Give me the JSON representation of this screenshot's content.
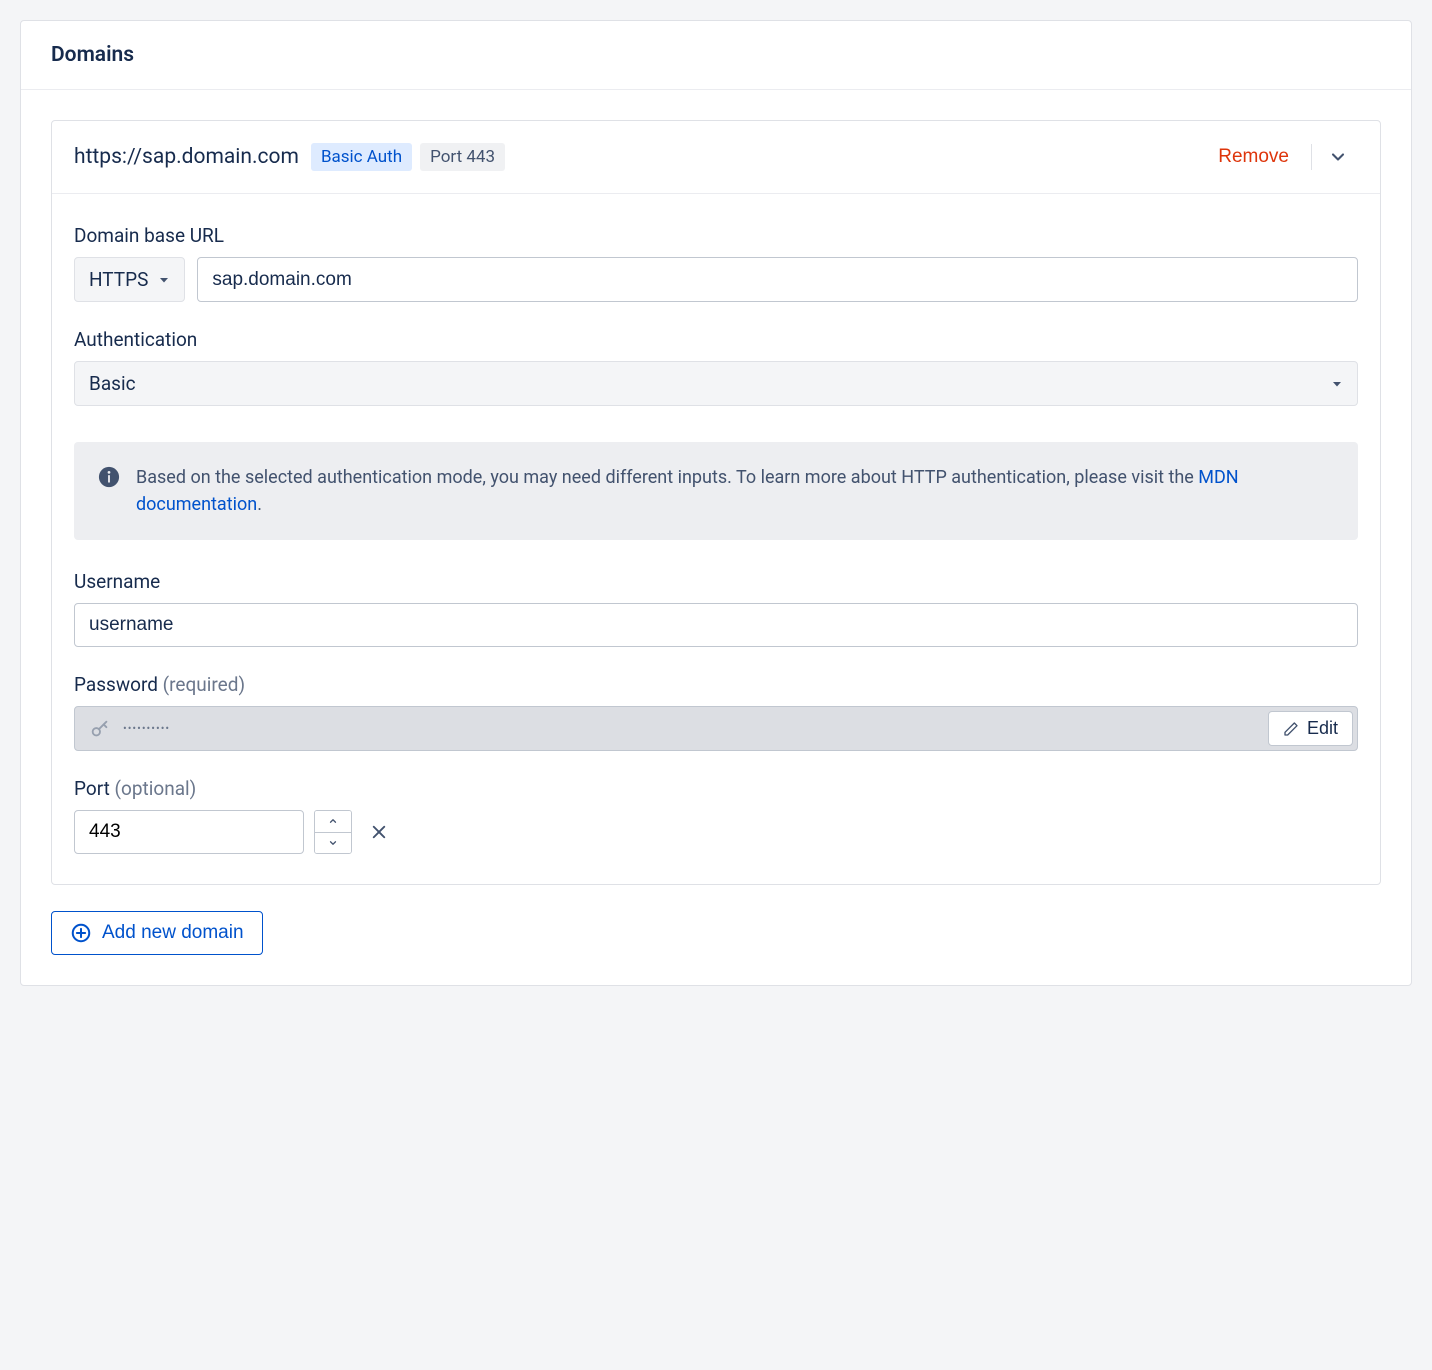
{
  "panel": {
    "title": "Domains"
  },
  "domain": {
    "url_display": "https://sap.domain.com",
    "auth_badge": "Basic Auth",
    "port_badge": "Port 443",
    "remove_label": "Remove"
  },
  "form": {
    "base_url_label": "Domain base URL",
    "protocol_value": "HTTPS",
    "domain_value": "sap.domain.com",
    "auth_label": "Authentication",
    "auth_value": "Basic",
    "info_text": "Based on the selected authentication mode, you may need different inputs. To learn more about HTTP authentication, please visit the ",
    "info_link_text": "MDN documentation",
    "info_suffix": ".",
    "username_label": "Username",
    "username_value": "username",
    "password_label": "Password",
    "password_hint": "(required)",
    "password_mask": "••••••••••",
    "edit_label": "Edit",
    "port_label": "Port",
    "port_hint": "(optional)",
    "port_value": "443"
  },
  "actions": {
    "add_domain_label": "Add new domain"
  }
}
